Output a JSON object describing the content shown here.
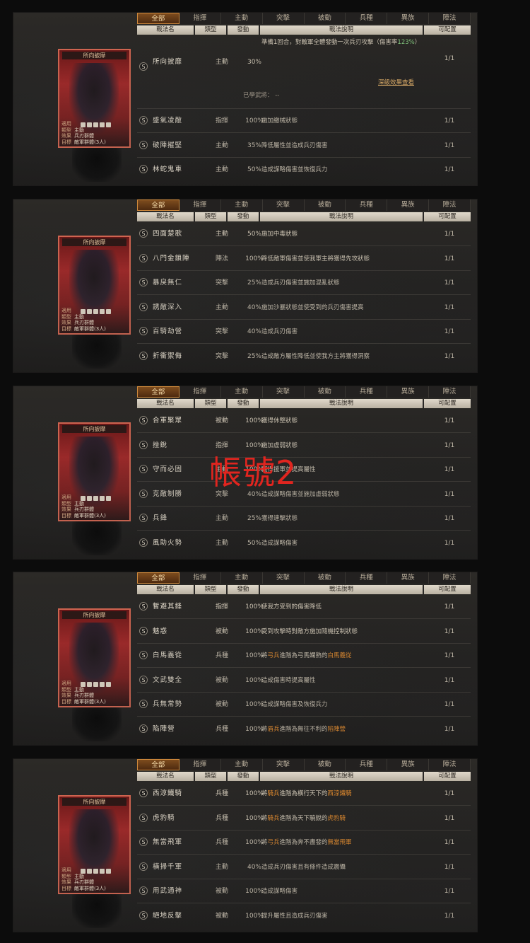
{
  "tabs": [
    "全部",
    "指揮",
    "主動",
    "突擊",
    "被動",
    "兵種",
    "異族",
    "陣法"
  ],
  "headers": [
    "戰法名",
    "類型",
    "發動",
    "戰法說明",
    "可配置"
  ],
  "card": {
    "title": "所向披靡",
    "lines": [
      {
        "k": "適用",
        "v": ""
      },
      {
        "k": "類型",
        "v": "主動"
      },
      {
        "k": "效果",
        "v": "兵刃群體"
      },
      {
        "k": "目標",
        "v": "敵軍群體(3人)"
      }
    ]
  },
  "watermark": "帳號2",
  "panels": [
    {
      "expanded": {
        "name": "所向披靡",
        "type": "主動",
        "prob": "30%",
        "desc_a": "準備1回合，對敵軍全體發動一次兵刃攻擊（傷害率",
        "desc_green": "123%",
        "desc_b": "）",
        "link": "深級效果查看",
        "learned": "已學武將： --",
        "count": "1/1"
      },
      "rows": [
        {
          "name": "盛氣凌敵",
          "type": "指揮",
          "prob": "100%",
          "desc": "施加繳械狀態",
          "count": "1/1"
        },
        {
          "name": "破陣摧堅",
          "type": "主動",
          "prob": "35%",
          "desc": "降低屬性並造成兵刃傷害",
          "count": "1/1"
        },
        {
          "name": "林蛇鬼車",
          "type": "主動",
          "prob": "50%",
          "desc": "造成謀略傷害並恢復兵力",
          "count": "1/1"
        }
      ]
    },
    {
      "rows": [
        {
          "name": "四面楚歌",
          "type": "主動",
          "prob": "50%",
          "desc": "施加中毒狀態",
          "count": "1/1"
        },
        {
          "name": "八門金鎖陣",
          "type": "陣法",
          "prob": "100%",
          "desc": "降低敵軍傷害並使我軍主將獲得先攻狀態",
          "count": "1/1"
        },
        {
          "name": "暴戾無仁",
          "type": "突擊",
          "prob": "25%",
          "desc": "造成兵刃傷害並施加混亂狀態",
          "count": "1/1"
        },
        {
          "name": "誘敵深入",
          "type": "主動",
          "prob": "40%",
          "desc": "施加沙暴狀態並使受到的兵刃傷害提高",
          "count": "1/1"
        },
        {
          "name": "百騎劫營",
          "type": "突擊",
          "prob": "40%",
          "desc": "造成兵刃傷害",
          "count": "1/1"
        },
        {
          "name": "折衝禦侮",
          "type": "突擊",
          "prob": "25%",
          "desc": "造成敵方屬性降低並使我方主將獲得洞察",
          "count": "1/1"
        }
      ]
    },
    {
      "rows": [
        {
          "name": "合軍聚眾",
          "type": "被動",
          "prob": "100%",
          "desc": "獲得休整狀態",
          "count": "1/1"
        },
        {
          "name": "挫銳",
          "type": "指揮",
          "prob": "100%",
          "desc": "施加虛弱狀態",
          "count": "1/1"
        },
        {
          "name": "守而必固",
          "type": "主動",
          "prob": "100%",
          "desc": "獲得援軍並提高屬性",
          "count": "1/1"
        },
        {
          "name": "克敵制勝",
          "type": "突擊",
          "prob": "40%",
          "desc": "造成謀略傷害並施加虛弱狀態",
          "count": "1/1"
        },
        {
          "name": "兵鋒",
          "type": "主動",
          "prob": "25%",
          "desc": "獲得連擊狀態",
          "count": "1/1"
        },
        {
          "name": "風助火勢",
          "type": "主動",
          "prob": "50%",
          "desc": "造成謀略傷害",
          "count": "1/1"
        }
      ]
    },
    {
      "rows": [
        {
          "name": "暫避其鋒",
          "type": "指揮",
          "prob": "100%",
          "desc": "使我方受到的傷害降低",
          "count": "1/1"
        },
        {
          "name": "魅惑",
          "type": "被動",
          "prob": "100%",
          "desc": "受到攻擊時對敵方施加隨機控制狀態",
          "count": "1/1"
        },
        {
          "name": "白馬義從",
          "type": "兵種",
          "prob": "100%",
          "desc_parts": [
            [
              "將",
              ""
            ],
            [
              "弓兵",
              "o"
            ],
            [
              "進階為弓馬嫻熟的",
              ""
            ],
            [
              "白馬義從",
              "o"
            ]
          ],
          "count": "1/1"
        },
        {
          "name": "文武雙全",
          "type": "被動",
          "prob": "100%",
          "desc": "造成傷害時提高屬性",
          "count": "1/1"
        },
        {
          "name": "兵無常勢",
          "type": "被動",
          "prob": "100%",
          "desc": "造成謀略傷害及恢復兵力",
          "count": "1/1"
        },
        {
          "name": "陷陣營",
          "type": "兵種",
          "prob": "100%",
          "desc_parts": [
            [
              "將",
              ""
            ],
            [
              "盾兵",
              "o"
            ],
            [
              "進階為無往不利的",
              ""
            ],
            [
              "陷陣營",
              "o"
            ]
          ],
          "count": "1/1"
        }
      ]
    },
    {
      "rows": [
        {
          "name": "西涼鐵騎",
          "type": "兵種",
          "prob": "100%",
          "desc_parts": [
            [
              "將",
              ""
            ],
            [
              "騎兵",
              "o"
            ],
            [
              "進階為橫行天下的",
              ""
            ],
            [
              "西涼鐵騎",
              "o"
            ]
          ],
          "count": "1/1"
        },
        {
          "name": "虎豹騎",
          "type": "兵種",
          "prob": "100%",
          "desc_parts": [
            [
              "將",
              ""
            ],
            [
              "騎兵",
              "o"
            ],
            [
              "進階為天下驍銳的",
              ""
            ],
            [
              "虎豹騎",
              "o"
            ]
          ],
          "count": "1/1"
        },
        {
          "name": "無當飛軍",
          "type": "兵種",
          "prob": "100%",
          "desc_parts": [
            [
              "將",
              ""
            ],
            [
              "弓兵",
              "o"
            ],
            [
              "進階為奔不盡發的",
              ""
            ],
            [
              "無當飛軍",
              "o"
            ]
          ],
          "count": "1/1"
        },
        {
          "name": "橫掃千軍",
          "type": "主動",
          "prob": "40%",
          "desc": "造成兵刃傷害且有條件造成震懾",
          "count": "1/1"
        },
        {
          "name": "用武通神",
          "type": "被動",
          "prob": "100%",
          "desc": "造成謀略傷害",
          "count": "1/1"
        },
        {
          "name": "絕地反擊",
          "type": "被動",
          "prob": "100%",
          "desc": "提升屬性且造成兵刃傷害",
          "count": "1/1"
        }
      ]
    }
  ]
}
